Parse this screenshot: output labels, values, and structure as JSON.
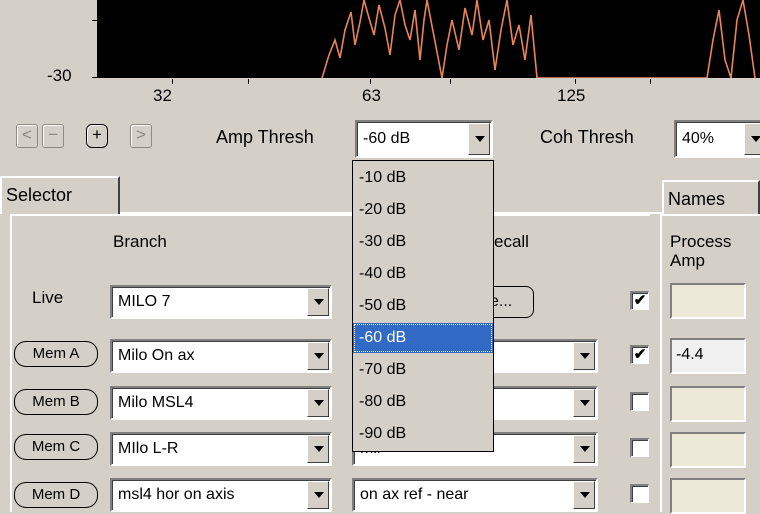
{
  "graph": {
    "y_label": "-30",
    "x_ticks": [
      "32",
      "63",
      "125"
    ],
    "trace_color": "#e8845a"
  },
  "toolbar": {
    "nav": [
      "<",
      "−",
      "+",
      ">"
    ],
    "amp_thresh_label": "Amp Thresh",
    "amp_thresh_value": "-60 dB",
    "coh_thresh_label": "Coh Thresh",
    "coh_thresh_value": "40%"
  },
  "tabs": {
    "selector": "Selector",
    "names": "Names"
  },
  "headers": {
    "branch": "Branch",
    "recall": "ecall",
    "process_amp": "Process\nAmp"
  },
  "rows": [
    {
      "label": "Live",
      "branch": "MILO  7",
      "recall": "e...",
      "checked": "✔",
      "amp": ""
    },
    {
      "label": "Mem A",
      "branch": "Milo On ax",
      "recall": "",
      "checked": "✔",
      "amp": "-4.4"
    },
    {
      "label": "Mem B",
      "branch": "Milo MSL4",
      "recall": "",
      "checked": "",
      "amp": ""
    },
    {
      "label": "Mem C",
      "branch": "MIlo L-R",
      "recall": "mil",
      "checked": "",
      "amp": ""
    },
    {
      "label": "Mem D",
      "branch": "msl4 hor on axis",
      "recall": "on ax ref - near",
      "checked": "",
      "amp": ""
    }
  ],
  "dropdown": {
    "options": [
      "-10 dB",
      "-20 dB",
      "-30 dB",
      "-40 dB",
      "-50 dB",
      "-60 dB",
      "-70 dB",
      "-80 dB",
      "-90 dB"
    ],
    "selected": "-60 dB"
  }
}
